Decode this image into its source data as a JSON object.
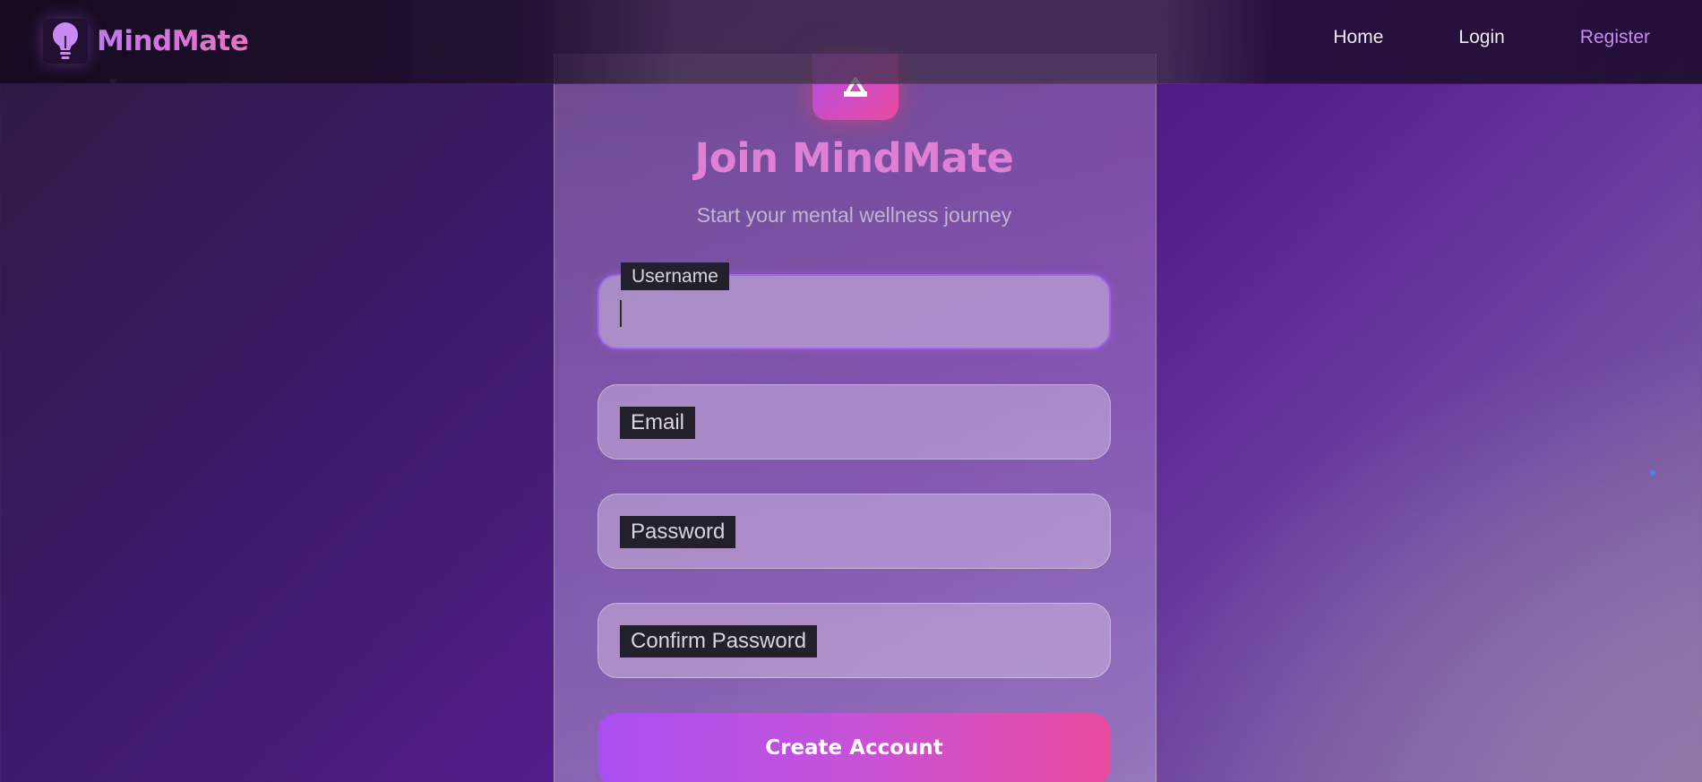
{
  "navbar": {
    "brand_name": "MindMate",
    "brand_icon": "lightbulb-icon",
    "links": [
      {
        "label": "Home",
        "active": false
      },
      {
        "label": "Login",
        "active": false
      },
      {
        "label": "Register",
        "active": true
      }
    ]
  },
  "register_card": {
    "icon": "user-icon",
    "title": "Join MindMate",
    "subtitle": "Start your mental wellness journey",
    "fields": {
      "username": {
        "label": "Username",
        "value": "",
        "focused": true
      },
      "email": {
        "label": "Email",
        "value": ""
      },
      "password": {
        "label": "Password",
        "value": ""
      },
      "confirm_password": {
        "label": "Confirm Password",
        "value": ""
      }
    },
    "submit_label": "Create Account"
  },
  "colors": {
    "accent_purple": "#a94ff0",
    "accent_pink": "#ea4b9e",
    "title_color": "#df7fd6",
    "active_link": "#c88af0"
  }
}
